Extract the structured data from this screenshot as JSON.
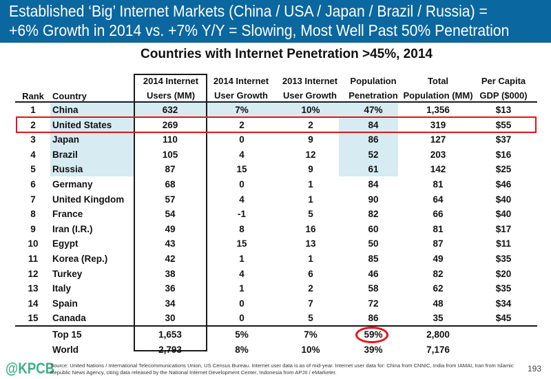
{
  "header": {
    "line1": "Established ‘Big’ Internet Markets (China / USA / Japan / Brazil / Russia) =",
    "line2": "+6% Growth in 2014 vs. +7% Y/Y = Slowing, Most Well Past  50% Penetration"
  },
  "table": {
    "title": "Countries with Internet Penetration >45%, 2014",
    "columns": [
      {
        "line1": "",
        "line2": "Rank"
      },
      {
        "line1": "",
        "line2": "Country"
      },
      {
        "line1": "2014 Internet",
        "line2": "Users (MM)"
      },
      {
        "line1": "2014 Internet",
        "line2": "User Growth"
      },
      {
        "line1": "2013 Internet",
        "line2": "User Growth"
      },
      {
        "line1": "Population",
        "line2": "Penetration"
      },
      {
        "line1": "Total",
        "line2": "Population (MM)"
      },
      {
        "line1": "Per Capita",
        "line2": "GDP ($000)"
      }
    ],
    "rows": [
      {
        "rank": "1",
        "country": "China",
        "users": "632",
        "growth2014": "7%",
        "growth2013": "10%",
        "penetration": "47%",
        "population": "1,356",
        "gdp": "$13"
      },
      {
        "rank": "2",
        "country": "United States",
        "users": "269",
        "growth2014": "2",
        "growth2013": "2",
        "penetration": "84",
        "population": "319",
        "gdp": "$55"
      },
      {
        "rank": "3",
        "country": "Japan",
        "users": "110",
        "growth2014": "0",
        "growth2013": "9",
        "penetration": "86",
        "population": "127",
        "gdp": "$37"
      },
      {
        "rank": "4",
        "country": "Brazil",
        "users": "105",
        "growth2014": "4",
        "growth2013": "12",
        "penetration": "52",
        "population": "203",
        "gdp": "$16"
      },
      {
        "rank": "5",
        "country": "Russia",
        "users": "87",
        "growth2014": "15",
        "growth2013": "9",
        "penetration": "61",
        "population": "142",
        "gdp": "$25"
      },
      {
        "rank": "6",
        "country": "Germany",
        "users": "68",
        "growth2014": "0",
        "growth2013": "1",
        "penetration": "84",
        "population": "81",
        "gdp": "$46"
      },
      {
        "rank": "7",
        "country": "United Kingdom",
        "users": "57",
        "growth2014": "4",
        "growth2013": "1",
        "penetration": "90",
        "population": "64",
        "gdp": "$40"
      },
      {
        "rank": "8",
        "country": "France",
        "users": "54",
        "growth2014": "-1",
        "growth2013": "5",
        "penetration": "82",
        "population": "66",
        "gdp": "$40"
      },
      {
        "rank": "9",
        "country": "Iran (I.R.)",
        "users": "49",
        "growth2014": "8",
        "growth2013": "16",
        "penetration": "60",
        "population": "81",
        "gdp": "$17"
      },
      {
        "rank": "10",
        "country": "Egypt",
        "users": "43",
        "growth2014": "15",
        "growth2013": "13",
        "penetration": "50",
        "population": "87",
        "gdp": "$11"
      },
      {
        "rank": "11",
        "country": "Korea (Rep.)",
        "users": "42",
        "growth2014": "1",
        "growth2013": "1",
        "penetration": "85",
        "population": "49",
        "gdp": "$35"
      },
      {
        "rank": "12",
        "country": "Turkey",
        "users": "38",
        "growth2014": "4",
        "growth2013": "6",
        "penetration": "46",
        "population": "82",
        "gdp": "$20"
      },
      {
        "rank": "13",
        "country": "Italy",
        "users": "36",
        "growth2014": "1",
        "growth2013": "2",
        "penetration": "58",
        "population": "62",
        "gdp": "$35"
      },
      {
        "rank": "14",
        "country": "Spain",
        "users": "34",
        "growth2014": "0",
        "growth2013": "7",
        "penetration": "72",
        "population": "48",
        "gdp": "$34"
      },
      {
        "rank": "15",
        "country": "Canada",
        "users": "30",
        "growth2014": "0",
        "growth2013": "5",
        "penetration": "86",
        "population": "35",
        "gdp": "$45"
      }
    ],
    "totals": [
      {
        "rank": "",
        "country": "Top 15",
        "users": "1,653",
        "growth2014": "5%",
        "growth2013": "7%",
        "penetration": "59%",
        "population": "2,800",
        "gdp": ""
      },
      {
        "rank": "",
        "country": "World",
        "users": "2,793",
        "growth2014": "8%",
        "growth2013": "10%",
        "penetration": "39%",
        "population": "7,176",
        "gdp": ""
      }
    ],
    "highlighted_row": "United States",
    "circled_value": "59%"
  },
  "footer": {
    "logo": "@KPCB",
    "source": "Source: United Nations / International Telecommunications Union, US Census Bureau. Internet user data is as of mid-year. Internet user data for: China from CNNIC, India from IAMAI, Iran from Islamic Republic News Agency, citing data released by the National Internet Development Center, Indonesia from APJII / eMarketer.",
    "page_number": "193"
  },
  "colors": {
    "header_bg": "#0b679f",
    "shade": "#d6ebf2",
    "highlight": "#e8101c",
    "logo": "#3db087"
  }
}
